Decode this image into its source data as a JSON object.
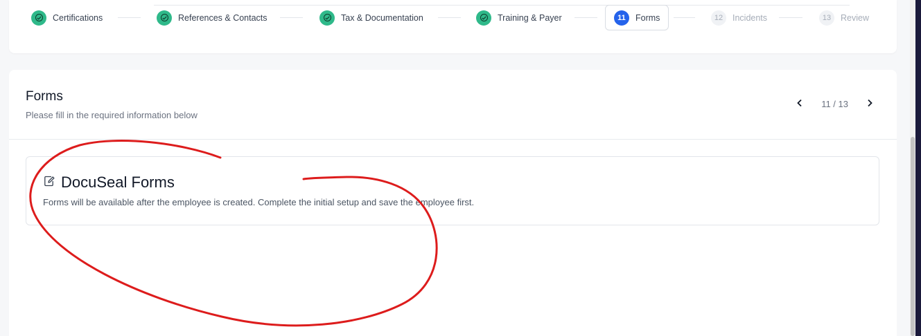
{
  "stepper": {
    "steps": [
      {
        "label": "Certifications",
        "state": "done"
      },
      {
        "label": "References & Contacts",
        "state": "done"
      },
      {
        "label": "Tax & Documentation",
        "state": "done"
      },
      {
        "label": "Training & Payer",
        "state": "done"
      },
      {
        "number": "11",
        "label": "Forms",
        "state": "active"
      },
      {
        "number": "12",
        "label": "Incidents",
        "state": "pending"
      },
      {
        "number": "13",
        "label": "Review",
        "state": "pending"
      }
    ]
  },
  "section": {
    "title": "Forms",
    "subtitle": "Please fill in the required information below",
    "pager": {
      "current": "11 / 13",
      "prev_icon": "chevron-left",
      "next_icon": "chevron-right"
    }
  },
  "docuseal": {
    "icon": "edit-document-icon",
    "title": "DocuSeal Forms",
    "description": "Forms will be available after the employee is created. Complete the initial setup and save the employee first."
  },
  "colors": {
    "done": "#2fb98a",
    "active": "#2563eb",
    "annotation": "#dd1c1c"
  }
}
